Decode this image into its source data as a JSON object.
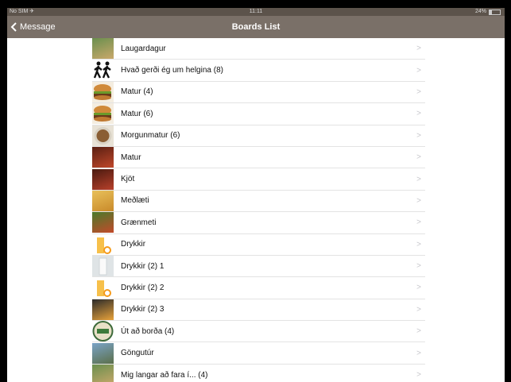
{
  "status_bar": {
    "carrier": "No SIM ✈",
    "time": "11:11",
    "battery": "24%",
    "battery_level": 0.24
  },
  "nav": {
    "back_label": "Message",
    "title": "Boards List"
  },
  "boards": [
    {
      "label": "Laugardagur",
      "icon": "outdoor-scene-icon"
    },
    {
      "label": "Hvað gerði ég um helgina (8)",
      "icon": "walking-people-icon"
    },
    {
      "label": "Matur (4)",
      "icon": "burger-icon"
    },
    {
      "label": "Matur (6)",
      "icon": "burger-icon"
    },
    {
      "label": "Morgunmatur (6)",
      "icon": "cereal-bowl-icon"
    },
    {
      "label": "Matur",
      "icon": "grill-food-icon"
    },
    {
      "label": "Kjöt",
      "icon": "meat-icon"
    },
    {
      "label": "Meðlæti",
      "icon": "fries-icon"
    },
    {
      "label": "Grænmeti",
      "icon": "vegetables-icon"
    },
    {
      "label": "Drykkir",
      "icon": "juice-glass-icon"
    },
    {
      "label": "Drykkir (2) 1",
      "icon": "milk-glass-icon"
    },
    {
      "label": "Drykkir (2) 2",
      "icon": "juice-glass-icon"
    },
    {
      "label": "Drykkir (2) 3",
      "icon": "coffee-icon"
    },
    {
      "label": "Út að borða (4)",
      "icon": "restaurant-badge-icon"
    },
    {
      "label": "Göngutúr",
      "icon": "landscape-icon"
    },
    {
      "label": "Mig langar að fara í... (4)",
      "icon": "outdoor-scene-icon"
    }
  ],
  "chevron": ">"
}
